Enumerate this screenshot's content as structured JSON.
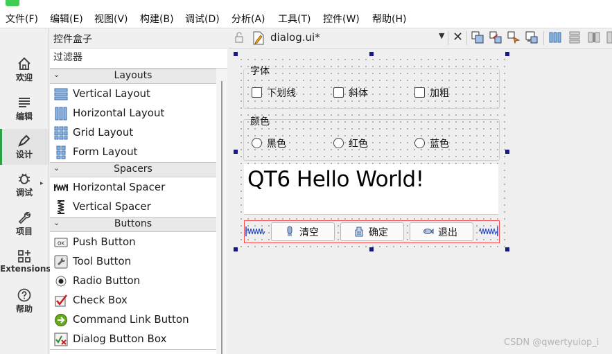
{
  "menubar": {
    "items": [
      "文件(F)",
      "编辑(E)",
      "视图(V)",
      "构建(B)",
      "调试(D)",
      "分析(A)",
      "工具(T)",
      "控件(W)",
      "帮助(H)"
    ]
  },
  "modes": [
    {
      "label": "欢迎",
      "icon": "home-icon"
    },
    {
      "label": "编辑",
      "icon": "edit-lines-icon"
    },
    {
      "label": "设计",
      "icon": "pen-icon",
      "active": true
    },
    {
      "label": "调试",
      "icon": "bug-icon"
    },
    {
      "label": "项目",
      "icon": "wrench-icon"
    },
    {
      "label": "Extensions",
      "icon": "extensions-icon"
    },
    {
      "label": "帮助",
      "icon": "help-icon"
    }
  ],
  "widget_box": {
    "title": "控件盒子",
    "filter_placeholder": "过滤器",
    "categories": {
      "layouts": "Layouts",
      "spacers": "Spacers",
      "buttons": "Buttons"
    },
    "layout_items": [
      "Vertical Layout",
      "Horizontal Layout",
      "Grid Layout",
      "Form Layout"
    ],
    "spacer_items": [
      "Horizontal Spacer",
      "Vertical Spacer"
    ],
    "button_items": [
      "Push Button",
      "Tool Button",
      "Radio Button",
      "Check Box",
      "Command Link Button",
      "Dialog Button Box"
    ]
  },
  "editor": {
    "file_name": "dialog.ui*"
  },
  "form": {
    "font_group": {
      "title": "字体",
      "checkboxes": [
        "下划线",
        "斜体",
        "加粗"
      ]
    },
    "color_group": {
      "title": "颜色",
      "radios": [
        "黑色",
        "红色",
        "蓝色"
      ]
    },
    "label_text": "QT6 Hello World!",
    "buttons": {
      "clear": "清空",
      "ok": "确定",
      "exit": "退出"
    }
  },
  "watermark": "CSDN @qwertyuiop_i",
  "colors": {
    "accent": "#2aa146",
    "selection_handle": "#17178a",
    "layout_outline": "#ff4b4b"
  }
}
